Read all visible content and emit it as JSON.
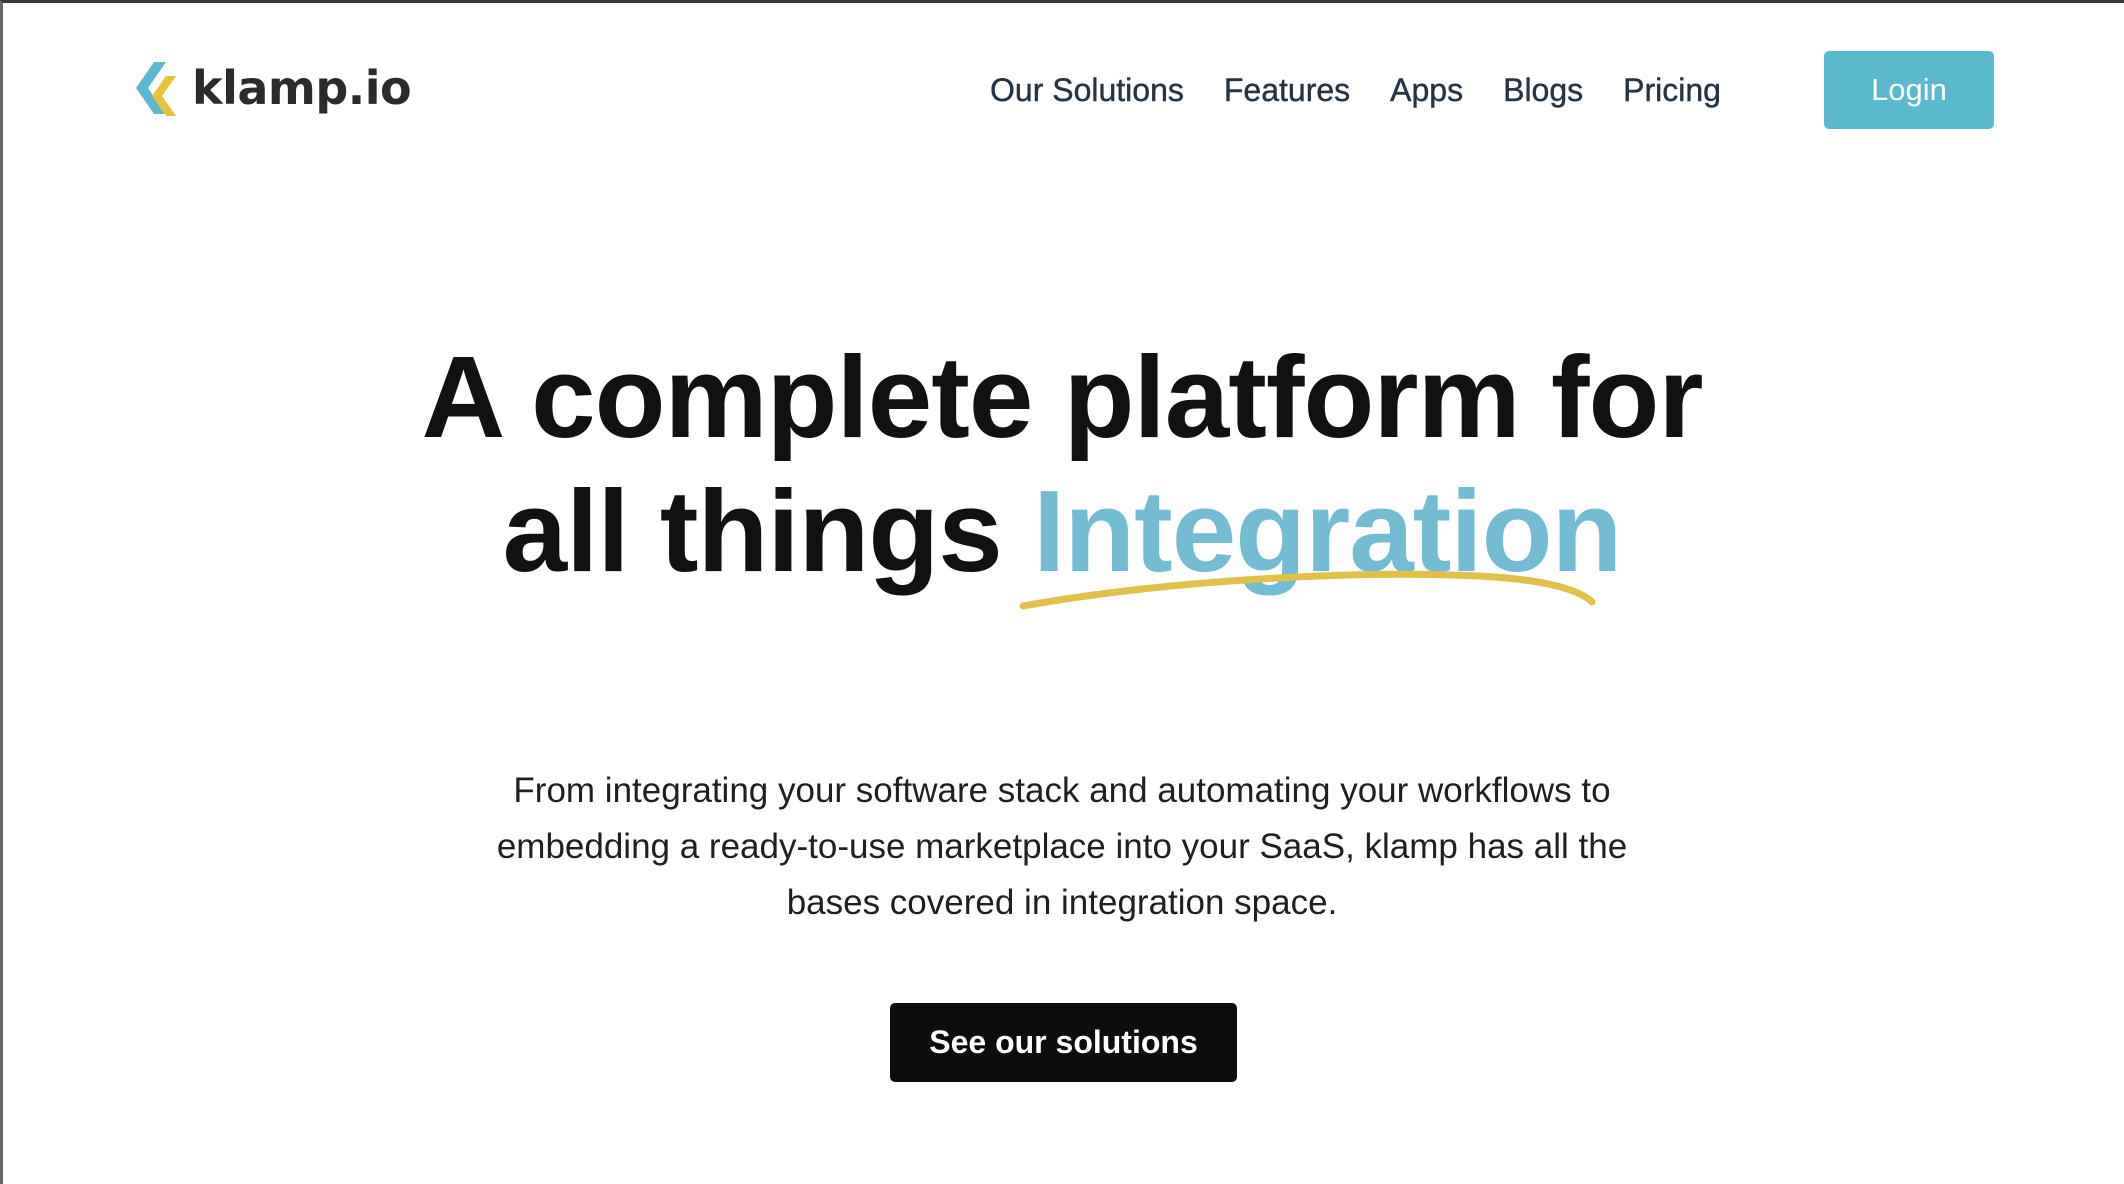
{
  "brand": {
    "name": "klamp.io",
    "colors": {
      "mark_blue": "#5ab9cf",
      "mark_yellow": "#e8c23a"
    }
  },
  "nav": {
    "items": [
      {
        "label": "Our Solutions"
      },
      {
        "label": "Features"
      },
      {
        "label": "Apps"
      },
      {
        "label": "Blogs"
      },
      {
        "label": "Pricing"
      }
    ],
    "login_label": "Login"
  },
  "hero": {
    "title_line1": "A complete platform for",
    "title_line2_prefix": "all things",
    "title_line2_accent": "Integration",
    "description": "From integrating your software stack and automating your workflows to embedding a ready-to-use marketplace into your SaaS, klamp has all the bases covered in integration space.",
    "cta_label": "See our solutions"
  },
  "colors": {
    "accent": "#72bcd4",
    "login_button": "#5ab9cf",
    "underline": "#e2c14a",
    "cta_button": "#0d0d0d",
    "text": "#111111"
  }
}
